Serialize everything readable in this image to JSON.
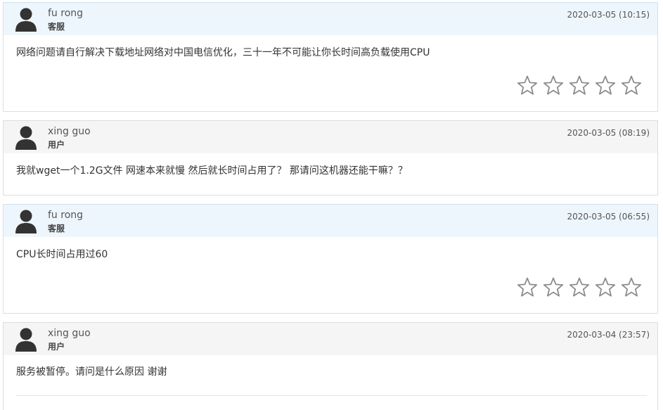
{
  "replies": [
    {
      "name": "fu rong",
      "role": "客服",
      "date": "2020-03-05 (10:15)",
      "message": "网络问题请自行解决下载地址网络对中国电信优化，三十一年不可能让你长时间高负载使用CPU",
      "is_staff": true,
      "rating_stars": 5
    },
    {
      "name": "xing guo",
      "role": "用户",
      "date": "2020-03-05 (08:19)",
      "message": "我就wget一个1.2G文件 网速本来就慢 然后就长时间占用了？ 那请问这机器还能干嘛？？",
      "is_staff": false
    },
    {
      "name": "fu rong",
      "role": "客服",
      "date": "2020-03-05 (06:55)",
      "message": "CPU长时间占用过60",
      "is_staff": true,
      "rating_stars": 5
    },
    {
      "name": "xing guo",
      "role": "用户",
      "date": "2020-03-04 (23:57)",
      "message": "服务被暂停。请问是什么原因 谢谢",
      "is_staff": false
    }
  ],
  "icons": {
    "avatar": "user-silhouette-icon",
    "rating": "star-outline-icon"
  },
  "colors": {
    "staff_header_bg": "#eef6fd",
    "user_header_bg": "#f5f5f5",
    "staff_border": "#cfe2ef",
    "user_border": "#dddddd",
    "star_stroke": "#8c8c8c",
    "avatar": "#333333"
  }
}
